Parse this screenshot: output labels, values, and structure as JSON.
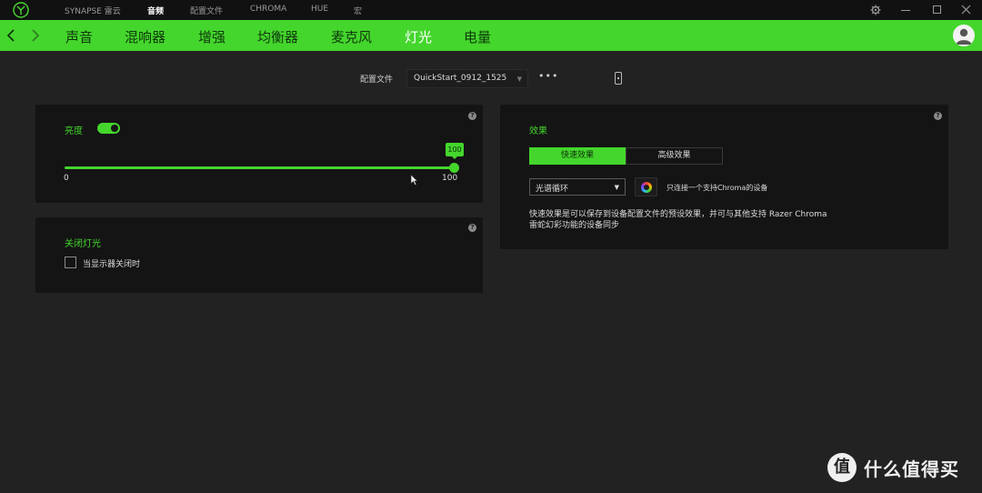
{
  "titlebar": {
    "app_name": "SYNAPSE 雷云",
    "tabs": [
      "音频",
      "配置文件",
      "CHROMA",
      "HUE",
      "宏"
    ],
    "active_tab": "音频"
  },
  "subnav": {
    "items": [
      "声音",
      "混响器",
      "增强",
      "均衡器",
      "麦克风",
      "灯光",
      "电量"
    ],
    "active_item": "灯光"
  },
  "profile": {
    "label": "配置文件",
    "value": "QuickStart_0912_1525",
    "more": "•••"
  },
  "brightness": {
    "label": "亮度",
    "enabled": true,
    "value": "100",
    "min_label": "0",
    "max_label": "100",
    "level": 1.0
  },
  "lights_off": {
    "title": "关闭灯光",
    "checkbox_label": "当显示器关闭时",
    "checked": false
  },
  "effects": {
    "title": "效果",
    "quick_tab": "快速效果",
    "advanced_tab": "高级效果",
    "selected_effect": "光谱循环",
    "chroma_link_text": "只连接一个支持Chroma的设备",
    "description": "快速效果是可以保存到设备配置文件的预设效果，并可与其他支持 Razer Chroma 雷蛇幻彩功能的设备同步"
  },
  "help_glyph": "?",
  "watermark": {
    "badge": "值",
    "text": "什么值得买"
  },
  "colors": {
    "accent": "#44d62c",
    "background": "#222222",
    "panel": "#141414",
    "titlebar": "#111111"
  }
}
